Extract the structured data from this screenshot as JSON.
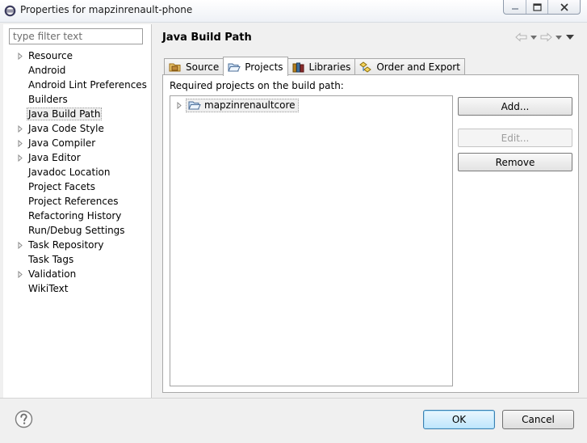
{
  "window": {
    "title": "Properties for mapzinrenault-phone",
    "icon": "eclipse-icon",
    "controls": [
      "minimize-icon",
      "maximize-icon",
      "close-icon"
    ]
  },
  "sidebar": {
    "filter_placeholder": "type filter text",
    "items": [
      {
        "label": "Resource",
        "expandable": true
      },
      {
        "label": "Android",
        "expandable": false
      },
      {
        "label": "Android Lint Preferences",
        "expandable": false
      },
      {
        "label": "Builders",
        "expandable": false
      },
      {
        "label": "Java Build Path",
        "expandable": false,
        "selected": true
      },
      {
        "label": "Java Code Style",
        "expandable": true
      },
      {
        "label": "Java Compiler",
        "expandable": true
      },
      {
        "label": "Java Editor",
        "expandable": true
      },
      {
        "label": "Javadoc Location",
        "expandable": false
      },
      {
        "label": "Project Facets",
        "expandable": false
      },
      {
        "label": "Project References",
        "expandable": false
      },
      {
        "label": "Refactoring History",
        "expandable": false
      },
      {
        "label": "Run/Debug Settings",
        "expandable": false
      },
      {
        "label": "Task Repository",
        "expandable": true
      },
      {
        "label": "Task Tags",
        "expandable": false
      },
      {
        "label": "Validation",
        "expandable": true
      },
      {
        "label": "WikiText",
        "expandable": false
      }
    ]
  },
  "page": {
    "title": "Java Build Path",
    "toolbar": [
      "back-arrow-icon",
      "dropdown-icon",
      "forward-arrow-icon",
      "dropdown-icon",
      "view-menu-icon"
    ]
  },
  "tabs": [
    {
      "label": "Source",
      "icon": "source-folder-icon"
    },
    {
      "label": "Projects",
      "icon": "project-folder-icon",
      "active": true
    },
    {
      "label": "Libraries",
      "icon": "libraries-icon"
    },
    {
      "label": "Order and Export",
      "icon": "order-export-icon"
    }
  ],
  "projects_tab": {
    "label": "Required projects on the build path:",
    "projects": [
      {
        "name": "mapzinrenaultcore",
        "icon": "project-folder-icon"
      }
    ],
    "buttons": {
      "add": "Add...",
      "edit": "Edit...",
      "remove": "Remove"
    }
  },
  "footer": {
    "help_icon": "help-icon",
    "ok": "OK",
    "cancel": "Cancel"
  },
  "colors": {
    "dialog_bg": "#f0f0f0",
    "default_button": "#bee6fd",
    "default_button_border": "#3c7fb1"
  }
}
